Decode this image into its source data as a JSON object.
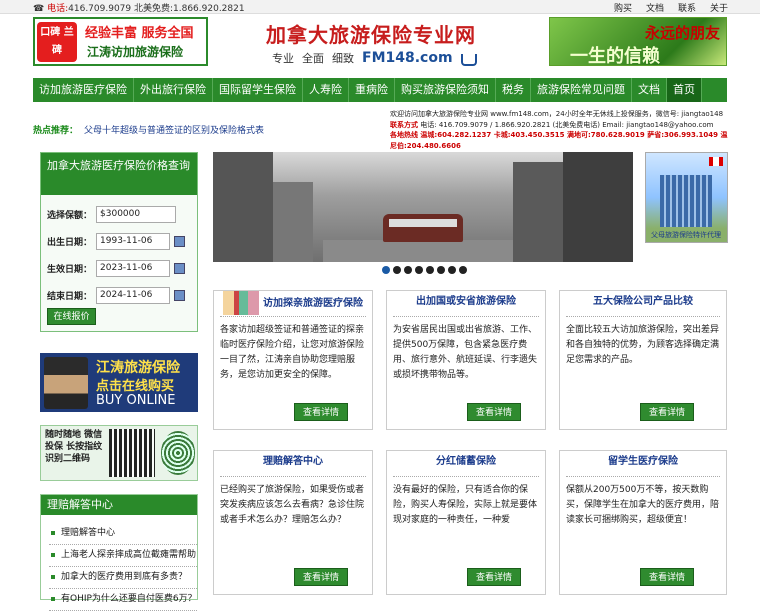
{
  "topbar": {
    "phone_label": "电话:",
    "phone_text": "416.709.9079 北美免费:1.866.920.2821",
    "links": [
      "购买",
      "文档",
      "联系",
      "关于"
    ]
  },
  "header": {
    "left_ad": {
      "badge": "口碑 兰碑",
      "line1": "经验丰富  服务全国",
      "line2": "江涛访加旅游保险"
    },
    "title": "加拿大旅游保险专业网",
    "tagline": [
      "专业",
      "全面",
      "细致"
    ],
    "domain": "FM148.com",
    "right_ad": {
      "line1": "永远的朋友",
      "line2": "一生的信赖"
    }
  },
  "nav": {
    "items": [
      "访加旅游医疗保险",
      "外出旅行保险",
      "国际留学生保险",
      "人寿险",
      "重病险",
      "购买旅游保险须知",
      "税务",
      "旅游保险常见问题",
      "文档",
      "首页"
    ],
    "active_index": 9
  },
  "hotline": {
    "label": "热点推荐：",
    "text": "父母十年超级与普通签证的区别及保险格式表"
  },
  "contact": {
    "line1": "欢迎访问加拿大旅游保险专业网 www.fm148.com，24小时全年无休线上投保服务，微信号: jiangtao148",
    "line2_label": "联系方式",
    "line2": "电话: 416.709.9079 / 1.866.920.2821 (北美免费电话)    Email: jiangtao148@yahoo.com",
    "line3": "各地热线 温城:604.282.1237 卡城:403.450.3515 满地可:780.628.9019 萨省:306.993.1049 温尼伯:204.480.6606"
  },
  "search": {
    "title": "加拿大旅游医疗保险价格查询",
    "amount_label": "选择保额：",
    "amount_value": "$300000",
    "birth_label": "出生日期：",
    "birth_value": "1993-11-06",
    "start_label": "生效日期：",
    "start_value": "2023-11-06",
    "end_label": "结束日期：",
    "end_value": "2024-11-06",
    "button": "在线报价"
  },
  "buy_online": {
    "line1": "江涛旅游保险",
    "line2": "点击在线购买",
    "line3": "BUY ONLINE"
  },
  "wechat": {
    "text": "随时随地 微信投保 长按指纹 识别二维码"
  },
  "claims": {
    "title": "理赔解答中心",
    "items": [
      "理赔解答中心",
      "上海老人探亲摔成高位截瘫需帮助",
      "加拿大的医疗费用到底有多贵？",
      "有OHIP为什么还要自付医费6万？"
    ]
  },
  "hotel": {
    "caption": "父母旅游保险特许代理"
  },
  "slider": {
    "count": 8,
    "active": 0
  },
  "cards": [
    {
      "title": "访加探亲旅游医疗保险",
      "body": "各家访加超级签证和普通签证的探亲临时医疗保险介绍，让您对旅游保险一目了然，江涛亲自协助您理赔服务，是您访加更安全的保障。",
      "button": "查看详情"
    },
    {
      "title": "出加国或安省旅游保险",
      "body": "为安省居民出国或出省旅游、工作、提供500万保障，包含紧急医疗费用、旅行意外、航班延误、行李遗失或损坏携带物品等。",
      "button": "查看详情"
    },
    {
      "title": "五大保险公司产品比较",
      "body": "全面比较五大访加旅游保险，突出差异和各自独特的优势，为顾客选择确定满足您需求的产品。",
      "button": "查看详情"
    },
    {
      "title": "理赔解答中心",
      "body": "已经购买了旅游保险，如果受伤或者突发疾病应该怎么去看病？急诊住院或者手术怎么办？理赔怎么办？",
      "button": "查看详情"
    },
    {
      "title": "分红储蓄保险",
      "body": "没有最好的保险，只有适合你的保险，购买人寿保险，实际上就是要体现对家庭的一种责任，一种爱",
      "button": "查看详情"
    },
    {
      "title": "留学生医疗保险",
      "body": "保额从200万500万不等，按天数购买，保障学生在加拿大的医疗费用，陪读家长可捆绑购买，超级便宜！",
      "button": "查看详情"
    }
  ]
}
